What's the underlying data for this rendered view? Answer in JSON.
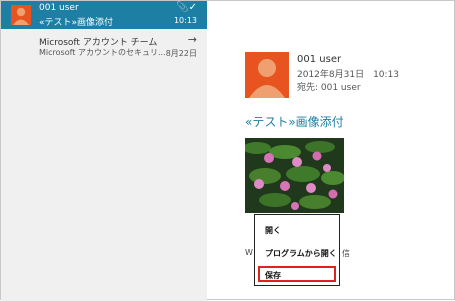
{
  "list": {
    "selected": {
      "sender": "001 user",
      "subject": "«テスト»画像添付",
      "icons": "📎✓",
      "time": "10:13"
    },
    "second": {
      "sender": "Microsoft アカウント チーム",
      "preview": "Microsoft アカウントのセキュリ...",
      "arrow": "→",
      "date": "8月22日"
    }
  },
  "reading": {
    "from": "001 user",
    "date": "2012年8月31日　10:13",
    "to": "宛先: 001 user",
    "subject": "«テスト»画像添付",
    "partial_left": "W",
    "partial_right": "信"
  },
  "context_menu": {
    "open": "開く",
    "open_with": "プログラムから開く",
    "save": "保存"
  }
}
